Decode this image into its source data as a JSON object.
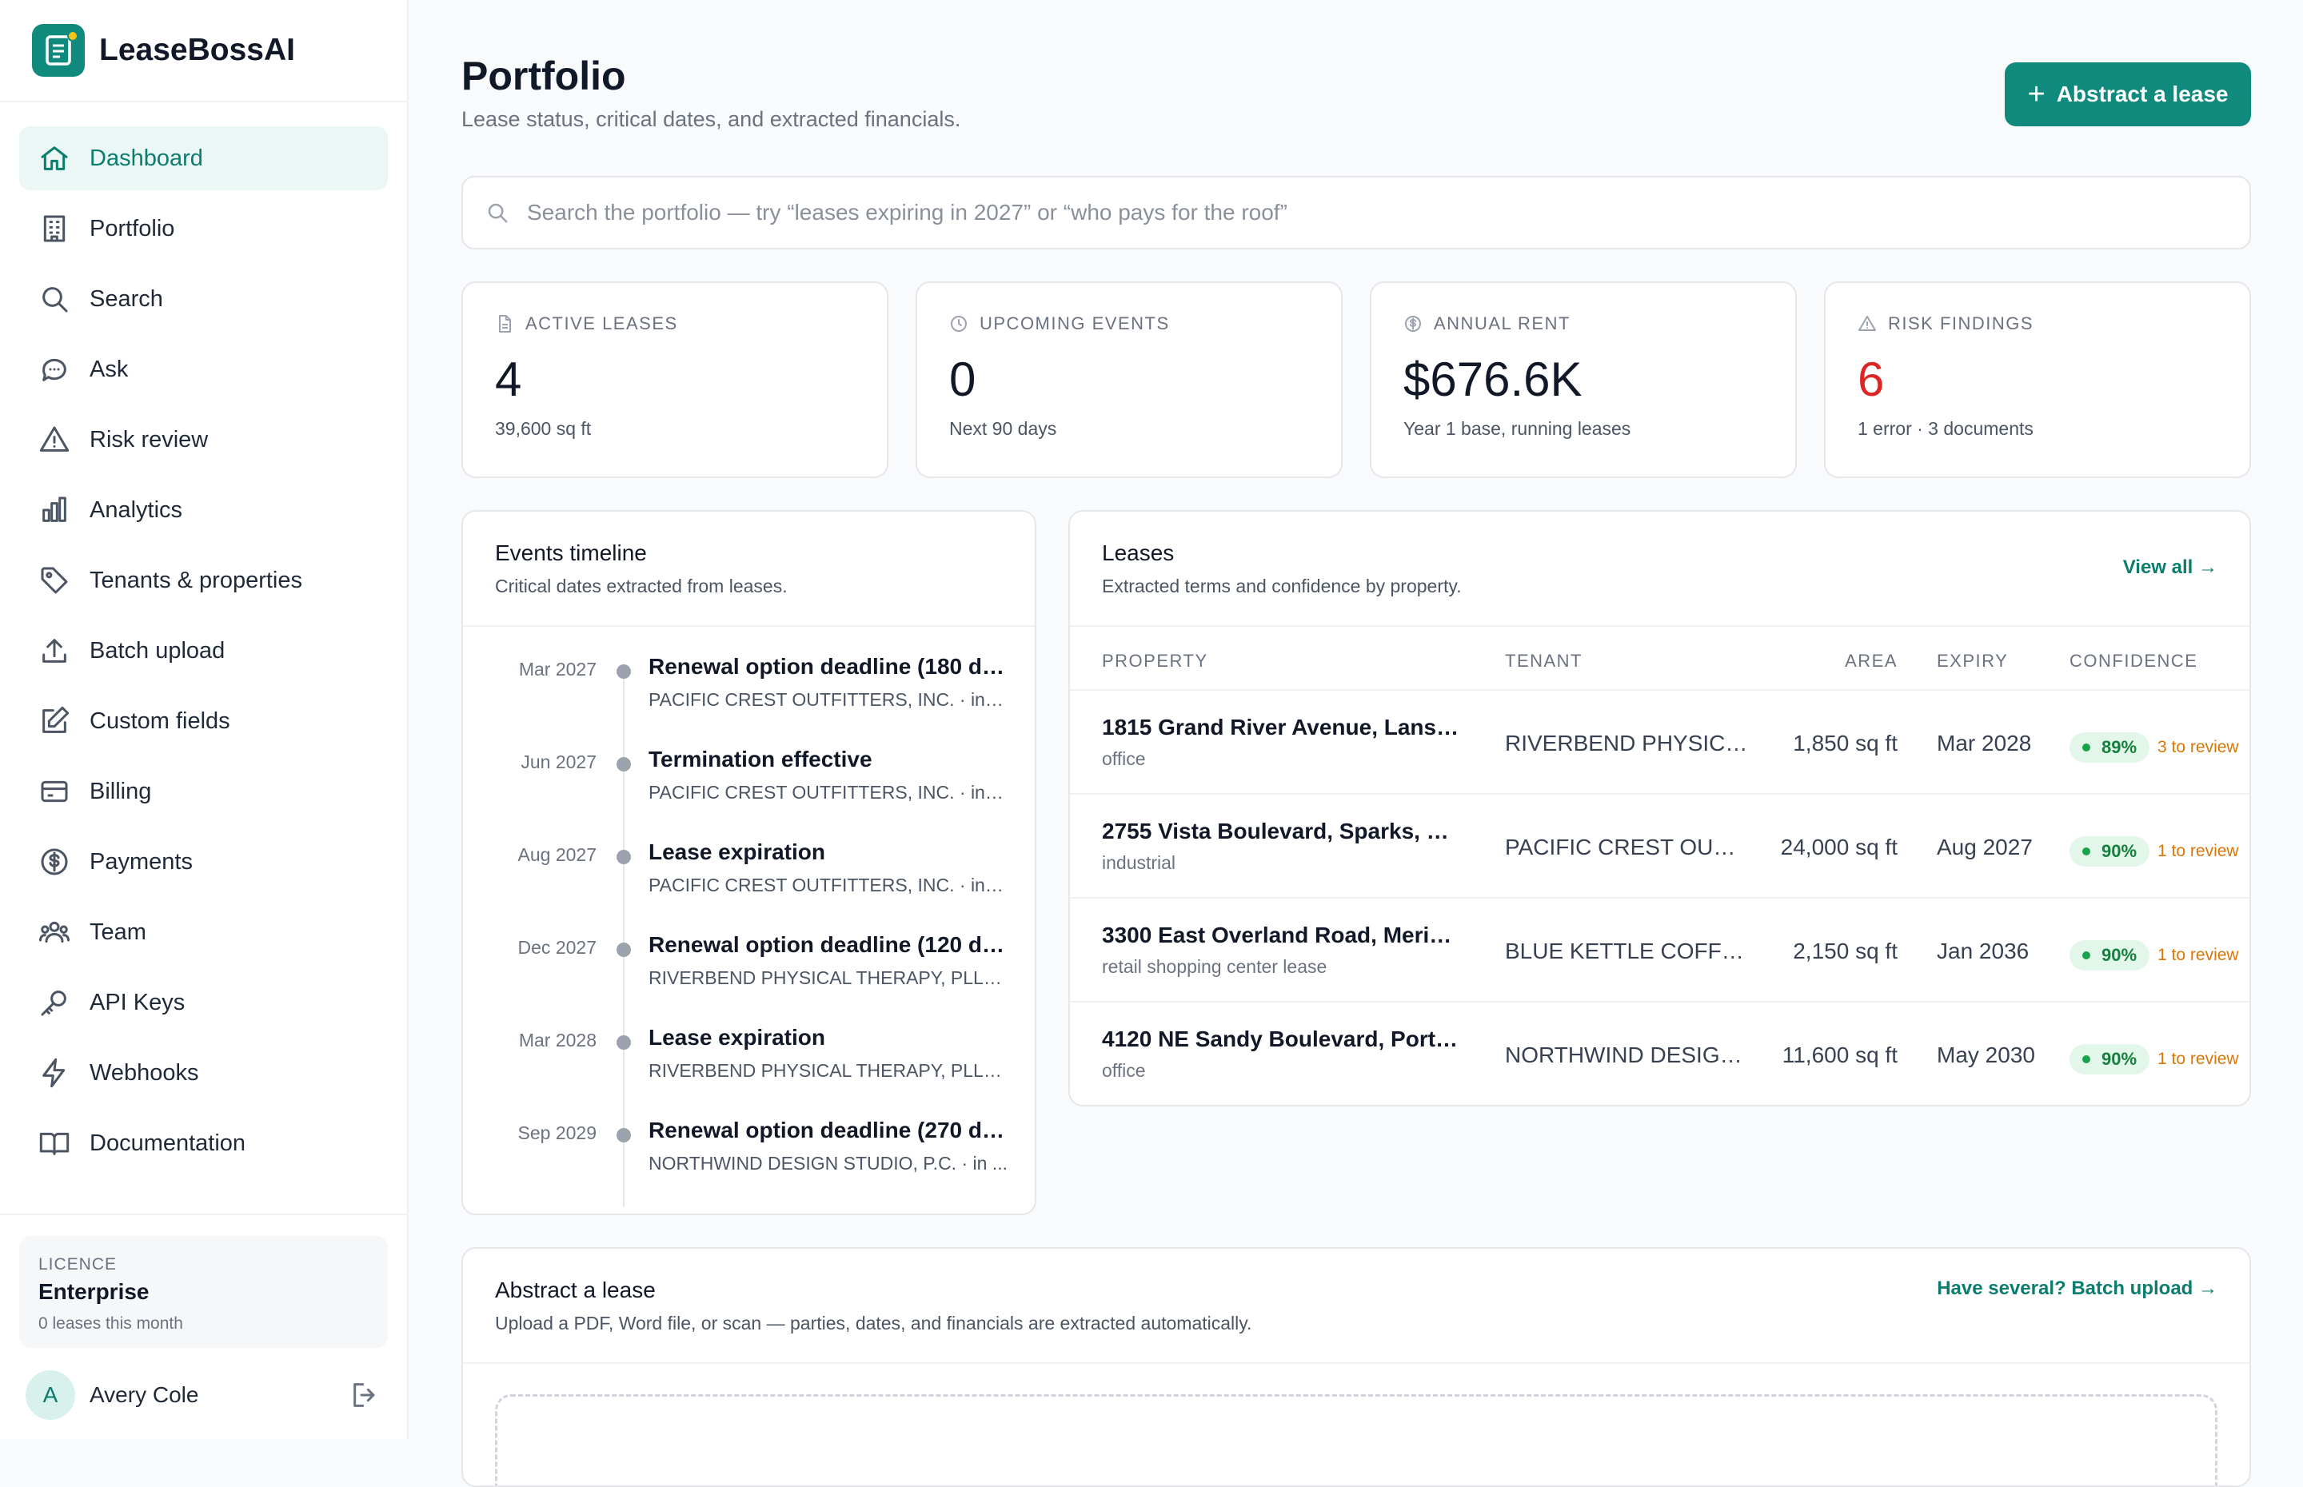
{
  "brand": {
    "name": "LeaseBossAI"
  },
  "nav": {
    "items": [
      {
        "label": "Dashboard",
        "icon": "home-icon",
        "name": "dashboard"
      },
      {
        "label": "Portfolio",
        "icon": "building-icon",
        "name": "portfolio"
      },
      {
        "label": "Search",
        "icon": "search-icon",
        "name": "search"
      },
      {
        "label": "Ask",
        "icon": "chat-bubble-icon",
        "name": "ask"
      },
      {
        "label": "Risk review",
        "icon": "warning-triangle-icon",
        "name": "risk-review"
      },
      {
        "label": "Analytics",
        "icon": "bar-chart-icon",
        "name": "analytics"
      },
      {
        "label": "Tenants & properties",
        "icon": "tag-icon",
        "name": "tenants-properties"
      },
      {
        "label": "Batch upload",
        "icon": "upload-icon",
        "name": "batch-upload"
      },
      {
        "label": "Custom fields",
        "icon": "edit-icon",
        "name": "custom-fields"
      },
      {
        "label": "Billing",
        "icon": "credit-card-icon",
        "name": "billing"
      },
      {
        "label": "Payments",
        "icon": "dollar-circle-icon",
        "name": "payments"
      },
      {
        "label": "Team",
        "icon": "users-icon",
        "name": "team"
      },
      {
        "label": "API Keys",
        "icon": "key-icon",
        "name": "api-keys"
      },
      {
        "label": "Webhooks",
        "icon": "lightning-icon",
        "name": "webhooks"
      },
      {
        "label": "Documentation",
        "icon": "book-icon",
        "name": "documentation"
      }
    ],
    "active": "Dashboard"
  },
  "licence": {
    "kicker": "LICENCE",
    "plan": "Enterprise",
    "usage": "0 leases this month"
  },
  "user": {
    "initial": "A",
    "name": "Avery Cole",
    "logout_icon": "logout-icon"
  },
  "header": {
    "title": "Portfolio",
    "subtitle": "Lease status, critical dates, and extracted financials.",
    "action_label": "Abstract a lease",
    "action_icon": "plus-icon"
  },
  "search": {
    "placeholder": "Search the portfolio — try “leases expiring in 2027” or “who pays for the roof”",
    "value": ""
  },
  "stats": [
    {
      "label": "ACTIVE LEASES",
      "icon": "document-icon",
      "value": "4",
      "sub": "39,600 sq ft"
    },
    {
      "label": "UPCOMING EVENTS",
      "icon": "clock-icon",
      "value": "0",
      "sub": "Next 90 days"
    },
    {
      "label": "ANNUAL RENT",
      "icon": "dollar-circle-icon",
      "value": "$676.6K",
      "sub": "Year 1 base, running leases"
    },
    {
      "label": "RISK FINDINGS",
      "icon": "warning-triangle-icon",
      "value": "6",
      "sub": "1 error · 3 documents",
      "color": "#dc2626"
    }
  ],
  "timeline": {
    "title": "Events timeline",
    "subtitle": "Critical dates extracted from leases.",
    "items": [
      {
        "date": "Mar 2027",
        "title": "Renewal option deadline (180 da...",
        "meta": "PACIFIC CREST OUTFITTERS, INC. · in 7 ..."
      },
      {
        "date": "Jun 2027",
        "title": "Termination effective",
        "meta": "PACIFIC CREST OUTFITTERS, INC. · in 11 ..."
      },
      {
        "date": "Aug 2027",
        "title": "Lease expiration",
        "meta": "PACIFIC CREST OUTFITTERS, INC. · in 13 ..."
      },
      {
        "date": "Dec 2027",
        "title": "Renewal option deadline (120 da...",
        "meta": "RIVERBEND PHYSICAL THERAPY, PLLC · i..."
      },
      {
        "date": "Mar 2028",
        "title": "Lease expiration",
        "meta": "RIVERBEND PHYSICAL THERAPY, PLLC · i..."
      },
      {
        "date": "Sep 2029",
        "title": "Renewal option deadline (270 da...",
        "meta": "NORTHWIND DESIGN STUDIO, P.C. · in ..."
      }
    ]
  },
  "leases": {
    "title": "Leases",
    "subtitle": "Extracted terms and confidence by property.",
    "view_all": "View all →",
    "columns": {
      "property": "PROPERTY",
      "tenant": "TENANT",
      "area": "AREA",
      "expiry": "EXPIRY",
      "confidence": "CONFIDENCE"
    },
    "rows": [
      {
        "property": "1815 Grand River Avenue, Lansin...",
        "type": "office",
        "tenant": "RIVERBEND PHYSICAL...",
        "area": "1,850 sq ft",
        "expiry": "Mar 2028",
        "confidence": "89%",
        "review": "3 to review"
      },
      {
        "property": "2755 Vista Boulevard, Sparks, Ne...",
        "type": "industrial",
        "tenant": "PACIFIC CREST OUTFIT...",
        "area": "24,000 sq ft",
        "expiry": "Aug 2027",
        "confidence": "90%",
        "review": "1 to review"
      },
      {
        "property": "3300 East Overland Road, Meridi...",
        "type": "retail shopping center lease",
        "tenant": "BLUE KETTLE COFFEE ...",
        "area": "2,150 sq ft",
        "expiry": "Jan 2036",
        "confidence": "90%",
        "review": "1 to review"
      },
      {
        "property": "4120 NE Sandy Boulevard, Portla...",
        "type": "office",
        "tenant": "NORTHWIND DESIGN ...",
        "area": "11,600 sq ft",
        "expiry": "May 2030",
        "confidence": "90%",
        "review": "1 to review"
      }
    ]
  },
  "abstract": {
    "title": "Abstract a lease",
    "subtitle": "Upload a PDF, Word file, or scan — parties, dates, and financials are extracted automatically.",
    "batch_link": "Have several? Batch upload →"
  },
  "colors": {
    "accent": "#0f8a7c",
    "danger": "#dc2626",
    "success": "#16a34a",
    "warning": "#d97706"
  }
}
